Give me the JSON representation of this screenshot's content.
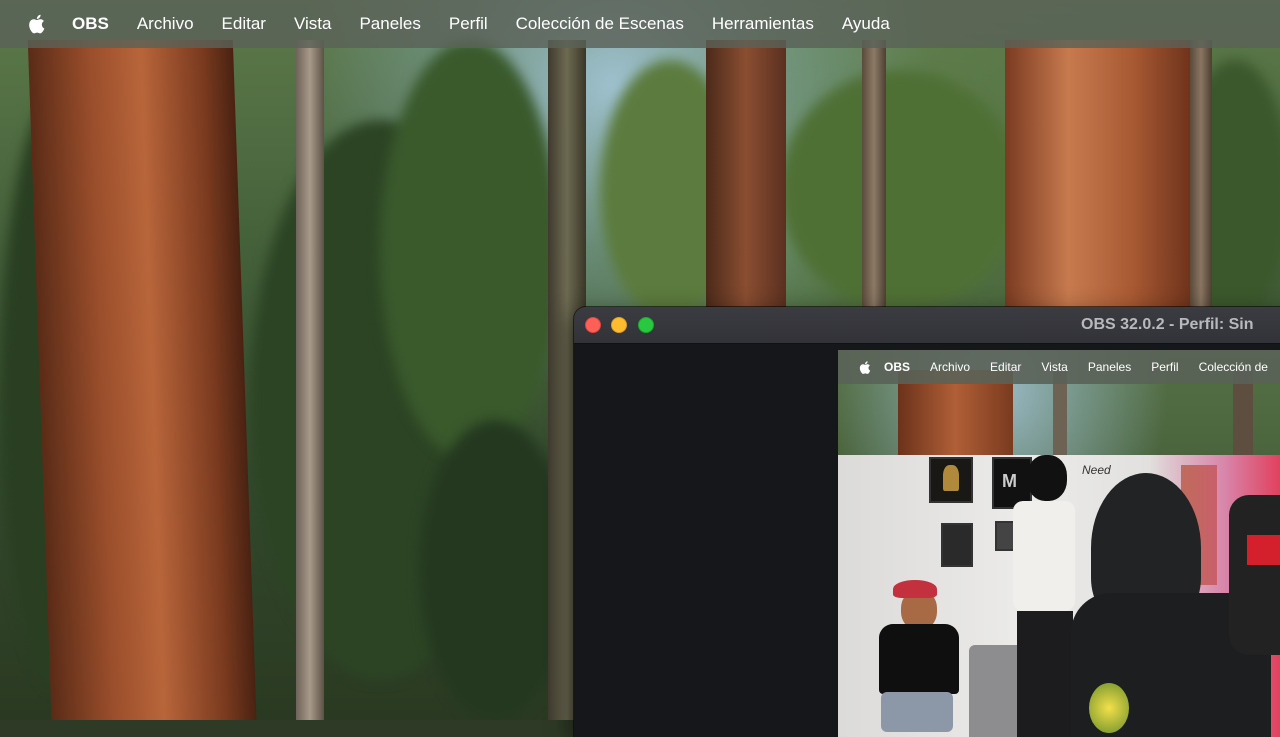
{
  "menubar": {
    "apple_icon": "apple-logo-icon",
    "app_name": "OBS",
    "items": [
      "Archivo",
      "Editar",
      "Vista",
      "Paneles",
      "Perfil",
      "Colección de Escenas",
      "Herramientas",
      "Ayuda"
    ]
  },
  "obs_window": {
    "title": "OBS 32.0.2 - Perfil: Sin",
    "traffic_lights": {
      "close": "#fe5f57",
      "minimize": "#febc2e",
      "maximize": "#28c840"
    }
  },
  "preview": {
    "menubar": {
      "app_name": "OBS",
      "items": [
        "Archivo",
        "Editar",
        "Vista",
        "Paneles",
        "Perfil",
        "Colección de"
      ]
    },
    "video": {
      "wall_text": "Need"
    }
  }
}
